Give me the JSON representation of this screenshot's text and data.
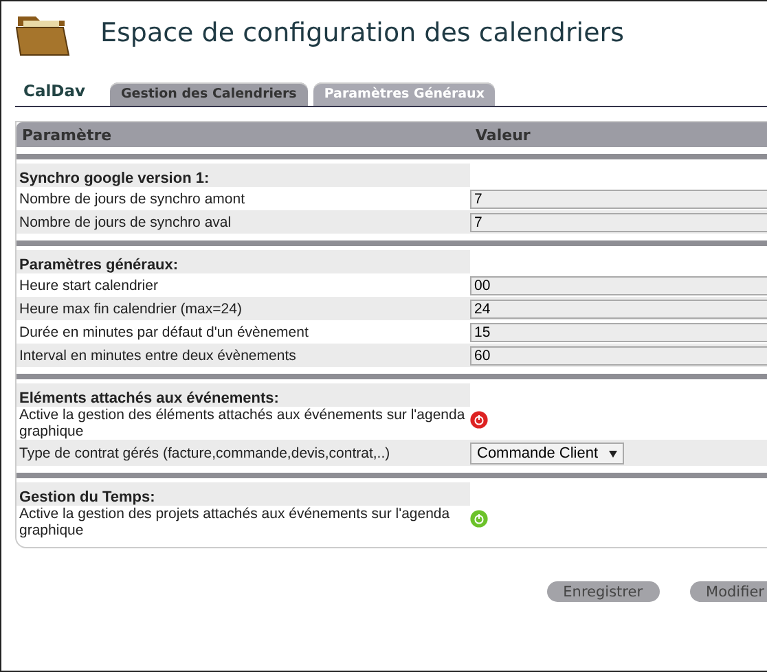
{
  "title": "Espace de configuration des calendriers",
  "module": "CalDav",
  "tabs": [
    {
      "label": "Gestion des Calendriers",
      "selected": false
    },
    {
      "label": "Paramètres Généraux",
      "selected": true
    }
  ],
  "table": {
    "columns": [
      "Paramètre",
      "Valeur"
    ],
    "sections": [
      {
        "title": "Synchro google version 1:",
        "rows": [
          {
            "kind": "input",
            "label": "Nombre de jours de synchro amont",
            "value": "7"
          },
          {
            "kind": "input",
            "label": "Nombre de jours de synchro aval",
            "value": "7"
          }
        ]
      },
      {
        "title": "Paramètres généraux:",
        "rows": [
          {
            "kind": "input",
            "label": "Heure start calendrier",
            "value": "00"
          },
          {
            "kind": "input",
            "label": "Heure max fin calendrier (max=24)",
            "value": "24"
          },
          {
            "kind": "input",
            "label": "Durée en minutes par défaut d'un évènement",
            "value": "15"
          },
          {
            "kind": "input",
            "label": "Interval en minutes entre deux évènements",
            "value": "60"
          }
        ]
      },
      {
        "title": "Eléments attachés aux événements:",
        "rows": [
          {
            "kind": "toggle",
            "label": "Active la gestion des éléments attachés aux événements sur l'agenda graphique",
            "on": false
          },
          {
            "kind": "select",
            "label": "Type de contrat gérés (facture,commande,devis,contrat,..)",
            "value": "Commande Client"
          }
        ]
      },
      {
        "title": "Gestion du Temps:",
        "rows": [
          {
            "kind": "toggle",
            "label": "Active la gestion des projets attachés aux événements sur l'agenda graphique",
            "on": true
          }
        ]
      }
    ]
  },
  "buttons": [
    "Enregistrer",
    "Modifier"
  ]
}
